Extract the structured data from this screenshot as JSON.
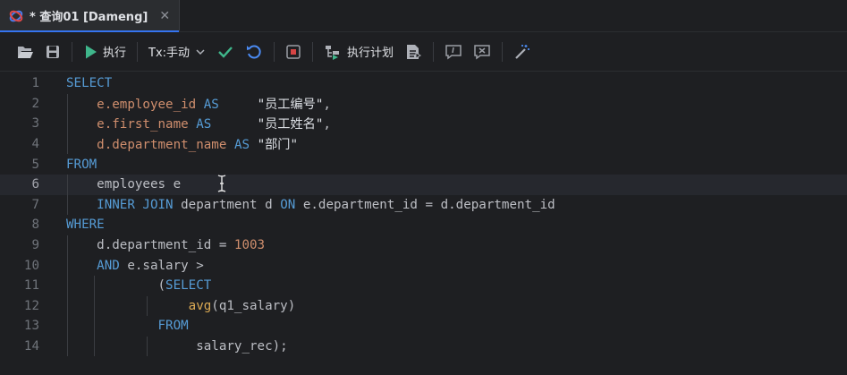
{
  "tab": {
    "title": "* 查询01 [Dameng]",
    "close_glyph": "✕",
    "icon": "database-icon"
  },
  "toolbar": {
    "open_icon": "folder-open-icon",
    "save_icon": "save-icon",
    "run_label": "执行",
    "tx_label": "Tx:手动",
    "commit_icon": "check-icon",
    "rollback_icon": "rollback-icon",
    "stop_icon": "stop-icon",
    "plan_label": "执行计划",
    "format_icon": "format-icon",
    "comment_icon": "comment-icon",
    "uncomment_icon": "uncomment-icon",
    "magic_icon": "magic-wand-icon"
  },
  "editor": {
    "active_line": 6,
    "lines": [
      {
        "n": "1",
        "tokens": [
          [
            "kw",
            "SELECT"
          ]
        ]
      },
      {
        "n": "2",
        "tokens": [
          [
            "t",
            "    "
          ],
          [
            "fld",
            "e.employee_id"
          ],
          [
            "t",
            " "
          ],
          [
            "kw",
            "AS"
          ],
          [
            "t",
            "     "
          ],
          [
            "str",
            "\"员工编号\""
          ],
          [
            "t",
            ","
          ]
        ]
      },
      {
        "n": "3",
        "tokens": [
          [
            "t",
            "    "
          ],
          [
            "fld",
            "e.first_name"
          ],
          [
            "t",
            " "
          ],
          [
            "kw",
            "AS"
          ],
          [
            "t",
            "      "
          ],
          [
            "str",
            "\"员工姓名\""
          ],
          [
            "t",
            ","
          ]
        ]
      },
      {
        "n": "4",
        "tokens": [
          [
            "t",
            "    "
          ],
          [
            "fld",
            "d.department_name"
          ],
          [
            "t",
            " "
          ],
          [
            "kw",
            "AS"
          ],
          [
            "t",
            " "
          ],
          [
            "str",
            "\"部门\""
          ]
        ]
      },
      {
        "n": "5",
        "tokens": [
          [
            "kw",
            "FROM"
          ]
        ]
      },
      {
        "n": "6",
        "tokens": [
          [
            "t",
            "    employees e"
          ]
        ]
      },
      {
        "n": "7",
        "tokens": [
          [
            "t",
            "    "
          ],
          [
            "kw",
            "INNER JOIN"
          ],
          [
            "t",
            " department d "
          ],
          [
            "kw",
            "ON"
          ],
          [
            "t",
            " e.department_id = d.department_id"
          ]
        ]
      },
      {
        "n": "8",
        "tokens": [
          [
            "kw",
            "WHERE"
          ]
        ]
      },
      {
        "n": "9",
        "tokens": [
          [
            "t",
            "    d.department_id = "
          ],
          [
            "num",
            "1003"
          ]
        ]
      },
      {
        "n": "10",
        "tokens": [
          [
            "t",
            "    "
          ],
          [
            "kw",
            "AND"
          ],
          [
            "t",
            " e.salary >"
          ]
        ]
      },
      {
        "n": "11",
        "tokens": [
          [
            "t",
            "            ("
          ],
          [
            "kw",
            "SELECT"
          ]
        ]
      },
      {
        "n": "12",
        "tokens": [
          [
            "t",
            "                "
          ],
          [
            "fn",
            "avg"
          ],
          [
            "t",
            "(q1_salary)"
          ]
        ]
      },
      {
        "n": "13",
        "tokens": [
          [
            "t",
            "            "
          ],
          [
            "kw",
            "FROM"
          ]
        ]
      },
      {
        "n": "14",
        "tokens": [
          [
            "t",
            "                 salary_rec);"
          ]
        ]
      }
    ]
  },
  "colors": {
    "keyword": "#569cd6",
    "field": "#cf8e6d",
    "accent": "#3574f0",
    "run": "#3fb68b"
  }
}
